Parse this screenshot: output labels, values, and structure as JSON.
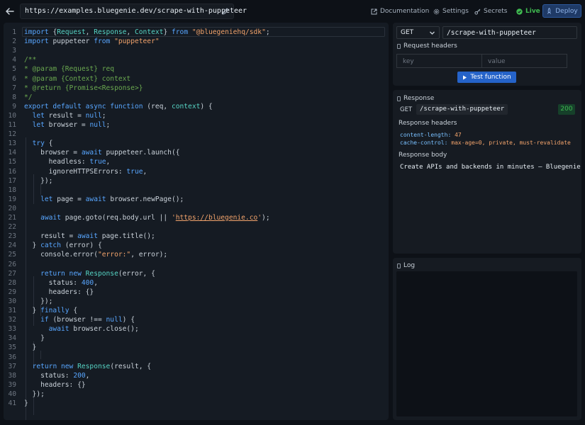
{
  "toolbar": {
    "url": "https://examples.bluegenie.dev/scrape-with-puppeteer",
    "nav": [
      "Documentation",
      "Settings",
      "Secrets"
    ],
    "live_label": "Live",
    "deploy_label": "Deploy"
  },
  "editor": {
    "lines": [
      [
        [
          "kw",
          "import"
        ],
        [
          "",
          "{"
        ],
        [
          "cls",
          "Request"
        ],
        [
          "",
          ", "
        ],
        [
          "cls",
          "Response"
        ],
        [
          "",
          ", "
        ],
        [
          "cls",
          "Context"
        ],
        [
          "",
          "} "
        ],
        [
          "kw",
          "from"
        ],
        [
          "",
          ""
        ],
        [
          "str",
          "\"@bluegeniehq/sdk\""
        ],
        [
          "",
          ";"
        ]
      ],
      [
        [
          "kw",
          "import"
        ],
        [
          "",
          "puppeteer "
        ],
        [
          "kw",
          "from"
        ],
        [
          "",
          ""
        ],
        [
          "str",
          "\"puppeteer\""
        ]
      ],
      [],
      [
        [
          "cm",
          "/**"
        ]
      ],
      [
        [
          "cm",
          "* @param {Request} req"
        ]
      ],
      [
        [
          "cm",
          "* @param {Context} context"
        ]
      ],
      [
        [
          "cm",
          "* @return {Promise<Response>}"
        ]
      ],
      [
        [
          "cm",
          "*/"
        ]
      ],
      [
        [
          "kw",
          "export default async function"
        ],
        [
          "",
          "(req, "
        ],
        [
          "cls",
          "context"
        ],
        [
          "",
          ") {"
        ]
      ],
      [
        [
          "",
          "  "
        ],
        [
          "kw",
          "let"
        ],
        [
          "",
          "result = "
        ],
        [
          "kw",
          "null"
        ],
        [
          "",
          ";"
        ]
      ],
      [
        [
          "",
          "  "
        ],
        [
          "kw",
          "let"
        ],
        [
          "",
          "browser = "
        ],
        [
          "kw",
          "null"
        ],
        [
          "",
          ";"
        ]
      ],
      [],
      [
        [
          "",
          "  "
        ],
        [
          "kw",
          "try"
        ],
        [
          "",
          "{"
        ]
      ],
      [
        [
          "",
          "    browser = "
        ],
        [
          "kw",
          "await"
        ],
        [
          "",
          "puppeteer.launch({"
        ]
      ],
      [
        [
          "",
          "      headless: "
        ],
        [
          "kw",
          "true"
        ],
        [
          "",
          ","
        ]
      ],
      [
        [
          "",
          "      ignoreHTTPSErrors: "
        ],
        [
          "kw",
          "true"
        ],
        [
          "",
          ","
        ]
      ],
      [
        [
          "",
          "    });"
        ]
      ],
      [],
      [
        [
          "",
          "    "
        ],
        [
          "kw",
          "let"
        ],
        [
          "",
          "page = "
        ],
        [
          "kw",
          "await"
        ],
        [
          "",
          "browser.newPage();"
        ]
      ],
      [],
      [
        [
          "",
          "    "
        ],
        [
          "kw",
          "await"
        ],
        [
          "",
          "page.goto(req.body.url || "
        ],
        [
          "str",
          "'"
        ],
        [
          "url",
          "https://bluegenie.co"
        ],
        [
          "str",
          "'"
        ],
        [
          "",
          ");"
        ]
      ],
      [],
      [
        [
          "",
          "    result = "
        ],
        [
          "kw",
          "await"
        ],
        [
          "",
          "page.title();"
        ]
      ],
      [
        [
          "",
          "  } "
        ],
        [
          "kw",
          "catch"
        ],
        [
          "",
          "(error) {"
        ]
      ],
      [
        [
          "",
          "    console.error("
        ],
        [
          "str",
          "\"error:\""
        ],
        [
          "",
          ", error);"
        ]
      ],
      [],
      [
        [
          "",
          "    "
        ],
        [
          "kw",
          "return new"
        ],
        [
          "",
          ""
        ],
        [
          "cls",
          "Response"
        ],
        [
          "",
          "(error, {"
        ]
      ],
      [
        [
          "",
          "      status: "
        ],
        [
          "num",
          "400"
        ],
        [
          "",
          ","
        ]
      ],
      [
        [
          "",
          "      headers: {}"
        ]
      ],
      [
        [
          "",
          "    });"
        ]
      ],
      [
        [
          "",
          "  } "
        ],
        [
          "kw",
          "finally"
        ],
        [
          "",
          "{"
        ]
      ],
      [
        [
          "",
          "    "
        ],
        [
          "kw",
          "if"
        ],
        [
          "",
          "(browser !== "
        ],
        [
          "kw",
          "null"
        ],
        [
          "",
          ") {"
        ]
      ],
      [
        [
          "",
          "      "
        ],
        [
          "kw",
          "await"
        ],
        [
          "",
          "browser.close();"
        ]
      ],
      [
        [
          "",
          "    }"
        ]
      ],
      [
        [
          "",
          "  }"
        ]
      ],
      [],
      [
        [
          "",
          "  "
        ],
        [
          "kw",
          "return new"
        ],
        [
          "",
          ""
        ],
        [
          "cls",
          "Response"
        ],
        [
          "",
          "(result, {"
        ]
      ],
      [
        [
          "",
          "    status: "
        ],
        [
          "num",
          "200"
        ],
        [
          "",
          ","
        ]
      ],
      [
        [
          "",
          "    headers: {}"
        ]
      ],
      [
        [
          "",
          "  });"
        ]
      ],
      [
        [
          "",
          "}"
        ]
      ]
    ]
  },
  "request": {
    "method": "GET",
    "path": "/scrape-with-puppeteer",
    "headers_label": "Request headers",
    "key_placeholder": "key",
    "value_placeholder": "value",
    "test_button": "Test function"
  },
  "response": {
    "label": "Response",
    "method": "GET",
    "path": "/scrape-with-puppeteer",
    "status": "200",
    "headers_label": "Response headers",
    "headers": [
      {
        "key": "content-length",
        "value": "47"
      },
      {
        "key": "cache-control",
        "value": "max-age=0, private, must-revalidate"
      }
    ],
    "body_label": "Response body",
    "body": "Create APIs and backends in minutes – Bluegenie"
  },
  "log": {
    "label": "Log"
  },
  "colors": {
    "keyword": "#58a6ff",
    "class": "#56d4c4",
    "string": "#f2a36b",
    "comment": "#6aa84f",
    "accent": "#2563c9",
    "status_ok": "#3fb950"
  },
  "icons": [
    "arrow-left-icon",
    "pencil-icon",
    "external-link-icon",
    "gear-icon",
    "key-icon",
    "check-circle-icon",
    "rocket-icon",
    "chevron-down-icon",
    "play-icon"
  ]
}
